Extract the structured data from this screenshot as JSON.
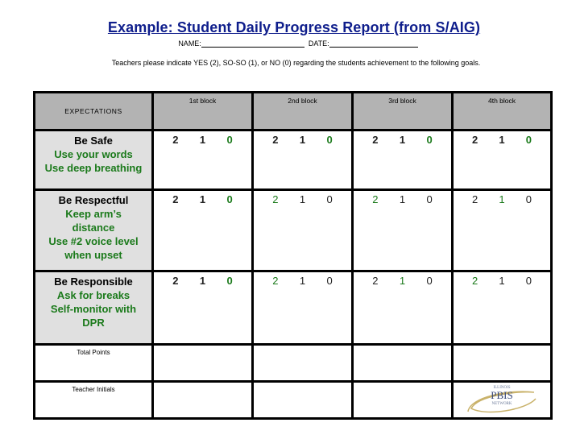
{
  "title": "Example:  Student Daily Progress Report (from S/AIG)",
  "name_label": "NAME:",
  "date_label": "DATE:",
  "instructions": "Teachers please indicate YES (2), SO-SO (1), or NO (0) regarding the students achievement to the following goals.",
  "table": {
    "expectations_header": "EXPECTATIONS",
    "blocks": [
      "1st block",
      "2nd block",
      "3rd block",
      "4th block"
    ],
    "rows": [
      {
        "title": "Be Safe",
        "details": [
          "Use your words",
          "Use deep breathing"
        ],
        "scores": [
          {
            "style": "bold",
            "values": [
              {
                "v": "2",
                "c": "d"
              },
              {
                "v": "1",
                "c": "d"
              },
              {
                "v": "0",
                "c": "g"
              }
            ]
          },
          {
            "style": "bold",
            "values": [
              {
                "v": "2",
                "c": "d"
              },
              {
                "v": "1",
                "c": "d"
              },
              {
                "v": "0",
                "c": "g"
              }
            ]
          },
          {
            "style": "bold",
            "values": [
              {
                "v": "2",
                "c": "d"
              },
              {
                "v": "1",
                "c": "d"
              },
              {
                "v": "0",
                "c": "g"
              }
            ]
          },
          {
            "style": "bold",
            "values": [
              {
                "v": "2",
                "c": "d"
              },
              {
                "v": "1",
                "c": "d"
              },
              {
                "v": "0",
                "c": "g"
              }
            ]
          }
        ]
      },
      {
        "title": "Be Respectful",
        "details": [
          "Keep arm’s",
          "distance",
          "Use #2 voice level",
          "when upset"
        ],
        "scores": [
          {
            "style": "bold",
            "values": [
              {
                "v": "2",
                "c": "d"
              },
              {
                "v": "1",
                "c": "d"
              },
              {
                "v": "0",
                "c": "g"
              }
            ]
          },
          {
            "style": "light",
            "values": [
              {
                "v": "2",
                "c": "g"
              },
              {
                "v": "1",
                "c": "d"
              },
              {
                "v": "0",
                "c": "d"
              }
            ]
          },
          {
            "style": "light",
            "values": [
              {
                "v": "2",
                "c": "g"
              },
              {
                "v": "1",
                "c": "d"
              },
              {
                "v": "0",
                "c": "d"
              }
            ]
          },
          {
            "style": "light",
            "values": [
              {
                "v": "2",
                "c": "d"
              },
              {
                "v": "1",
                "c": "g"
              },
              {
                "v": "0",
                "c": "d"
              }
            ]
          }
        ]
      },
      {
        "title": "Be Responsible",
        "details": [
          "Ask for breaks",
          "Self-monitor with",
          "DPR"
        ],
        "scores": [
          {
            "style": "bold",
            "values": [
              {
                "v": "2",
                "c": "d"
              },
              {
                "v": "1",
                "c": "d"
              },
              {
                "v": "0",
                "c": "g"
              }
            ]
          },
          {
            "style": "light",
            "values": [
              {
                "v": "2",
                "c": "g"
              },
              {
                "v": "1",
                "c": "d"
              },
              {
                "v": "0",
                "c": "d"
              }
            ]
          },
          {
            "style": "light",
            "values": [
              {
                "v": "2",
                "c": "d"
              },
              {
                "v": "1",
                "c": "g"
              },
              {
                "v": "0",
                "c": "d"
              }
            ]
          },
          {
            "style": "light",
            "values": [
              {
                "v": "2",
                "c": "g"
              },
              {
                "v": "1",
                "c": "d"
              },
              {
                "v": "0",
                "c": "d"
              }
            ]
          }
        ]
      }
    ],
    "total_points_label": "Total Points",
    "teacher_initials_label": "Teacher Initials"
  },
  "logo": {
    "top": "ILLINOIS",
    "middle": "PBIS",
    "bottom": "NETWORK"
  },
  "colors": {
    "title": "#0f1e8c",
    "green": "#1b7a1b",
    "header_gray": "#b3b3b3",
    "label_gray": "#e0e0e0"
  }
}
